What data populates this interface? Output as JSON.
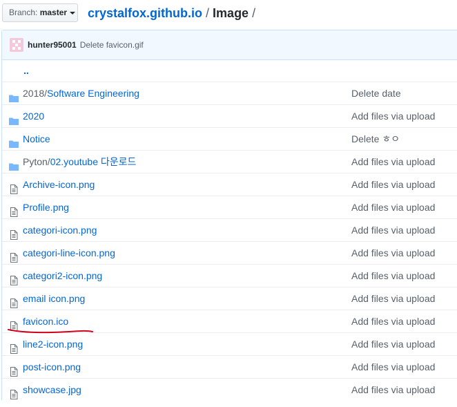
{
  "branch": {
    "prefix": "Branch:",
    "name": "master"
  },
  "breadcrumb": {
    "repo": "crystalfox.github.io",
    "sep1": "/",
    "folder": "Image",
    "sep2": "/"
  },
  "commit": {
    "author": "hunter95001",
    "message": "Delete favicon.gif"
  },
  "parent_dir": "..",
  "files": [
    {
      "type": "folder",
      "prefix": "2018/",
      "name": "Software Engineering",
      "message": "Delete date"
    },
    {
      "type": "folder",
      "prefix": "",
      "name": "2020",
      "message": "Add files via upload"
    },
    {
      "type": "folder",
      "prefix": "",
      "name": "Notice",
      "message": "Delete ㅎㅇ"
    },
    {
      "type": "folder",
      "prefix": "Pyton/",
      "name": "02.youtube 다운로드",
      "message": "Add files via upload"
    },
    {
      "type": "file",
      "prefix": "",
      "name": "Archive-icon.png",
      "message": "Add files via upload"
    },
    {
      "type": "file",
      "prefix": "",
      "name": "Profile.png",
      "message": "Add files via upload"
    },
    {
      "type": "file",
      "prefix": "",
      "name": "categori-icon.png",
      "message": "Add files via upload"
    },
    {
      "type": "file",
      "prefix": "",
      "name": "categori-line-icon.png",
      "message": "Add files via upload"
    },
    {
      "type": "file",
      "prefix": "",
      "name": "categori2-icon.png",
      "message": "Add files via upload"
    },
    {
      "type": "file",
      "prefix": "",
      "name": "email icon.png",
      "message": "Add files via upload"
    },
    {
      "type": "file",
      "prefix": "",
      "name": "favicon.ico",
      "message": "Add files via upload"
    },
    {
      "type": "file",
      "prefix": "",
      "name": "line2-icon.png",
      "message": "Add files via upload"
    },
    {
      "type": "file",
      "prefix": "",
      "name": "post-icon.png",
      "message": "Add files via upload"
    },
    {
      "type": "file",
      "prefix": "",
      "name": "showcase.jpg",
      "message": "Add files via upload"
    }
  ],
  "colors": {
    "link": "#0366d6",
    "folder_icon": "#79b8ff",
    "file_icon": "#6a737d",
    "annotation": "#d0021b"
  },
  "icons": {
    "folder": "folder-icon",
    "file": "file-icon",
    "caret": "caret-down-icon"
  }
}
